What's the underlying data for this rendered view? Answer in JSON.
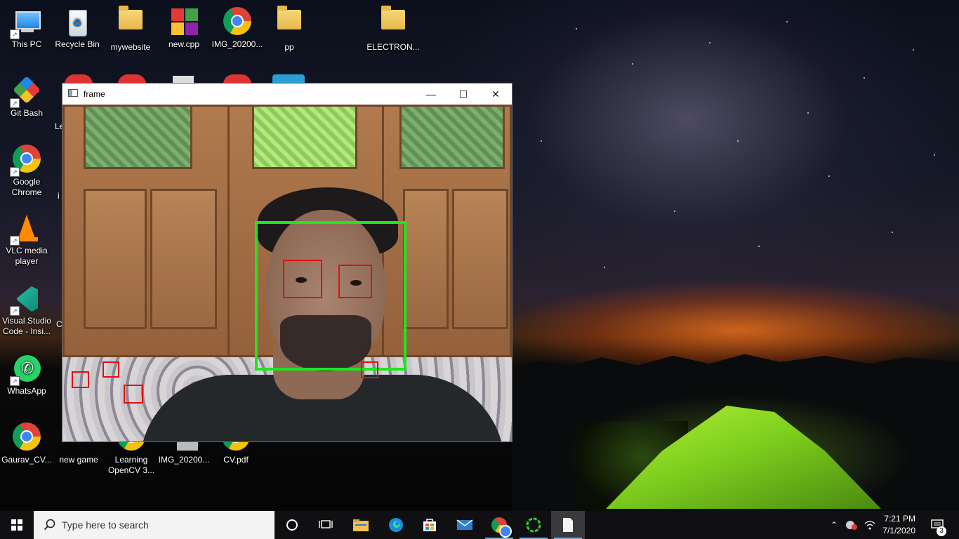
{
  "desktop": {
    "icons": [
      {
        "label": "This PC"
      },
      {
        "label": "Recycle Bin"
      },
      {
        "label": "mywebsite"
      },
      {
        "label": "new.cpp"
      },
      {
        "label": "IMG_20200..."
      },
      {
        "label": "pp"
      },
      {
        "label": "ELECTRON..."
      },
      {
        "label": "Git Bash"
      },
      {
        "label": "Google Chrome"
      },
      {
        "label": "VLC media player"
      },
      {
        "label": "Visual Studio Code - Insi..."
      },
      {
        "label": "WhatsApp"
      },
      {
        "label": "Gaurav_CV..."
      },
      {
        "label": "new game"
      },
      {
        "label": "Learning OpenCV 3..."
      },
      {
        "label": "IMG_20200..."
      },
      {
        "label": "CV.pdf"
      }
    ],
    "partial_labels": [
      "Le",
      "i",
      "C"
    ]
  },
  "window": {
    "title": "frame",
    "minimize_symbol": "—",
    "maximize_symbol": "☐",
    "close_symbol": "✕",
    "detections": {
      "face_color": "#1ee61e",
      "feature_color": "#e01010",
      "face_count": 1,
      "feature_box_count": 6
    }
  },
  "taskbar": {
    "search_placeholder": "Type here to search",
    "pinned": [
      {
        "icon": "cortana-icon"
      },
      {
        "icon": "task-view-icon"
      },
      {
        "icon": "file-explorer-icon"
      },
      {
        "icon": "edge-icon"
      },
      {
        "icon": "store-icon"
      },
      {
        "icon": "mail-icon"
      },
      {
        "icon": "chrome-icon"
      },
      {
        "icon": "app-loading-icon"
      },
      {
        "icon": "document-icon"
      }
    ],
    "tray": {
      "time": "7:21 PM",
      "date": "7/1/2020",
      "notification_count": "3"
    }
  }
}
